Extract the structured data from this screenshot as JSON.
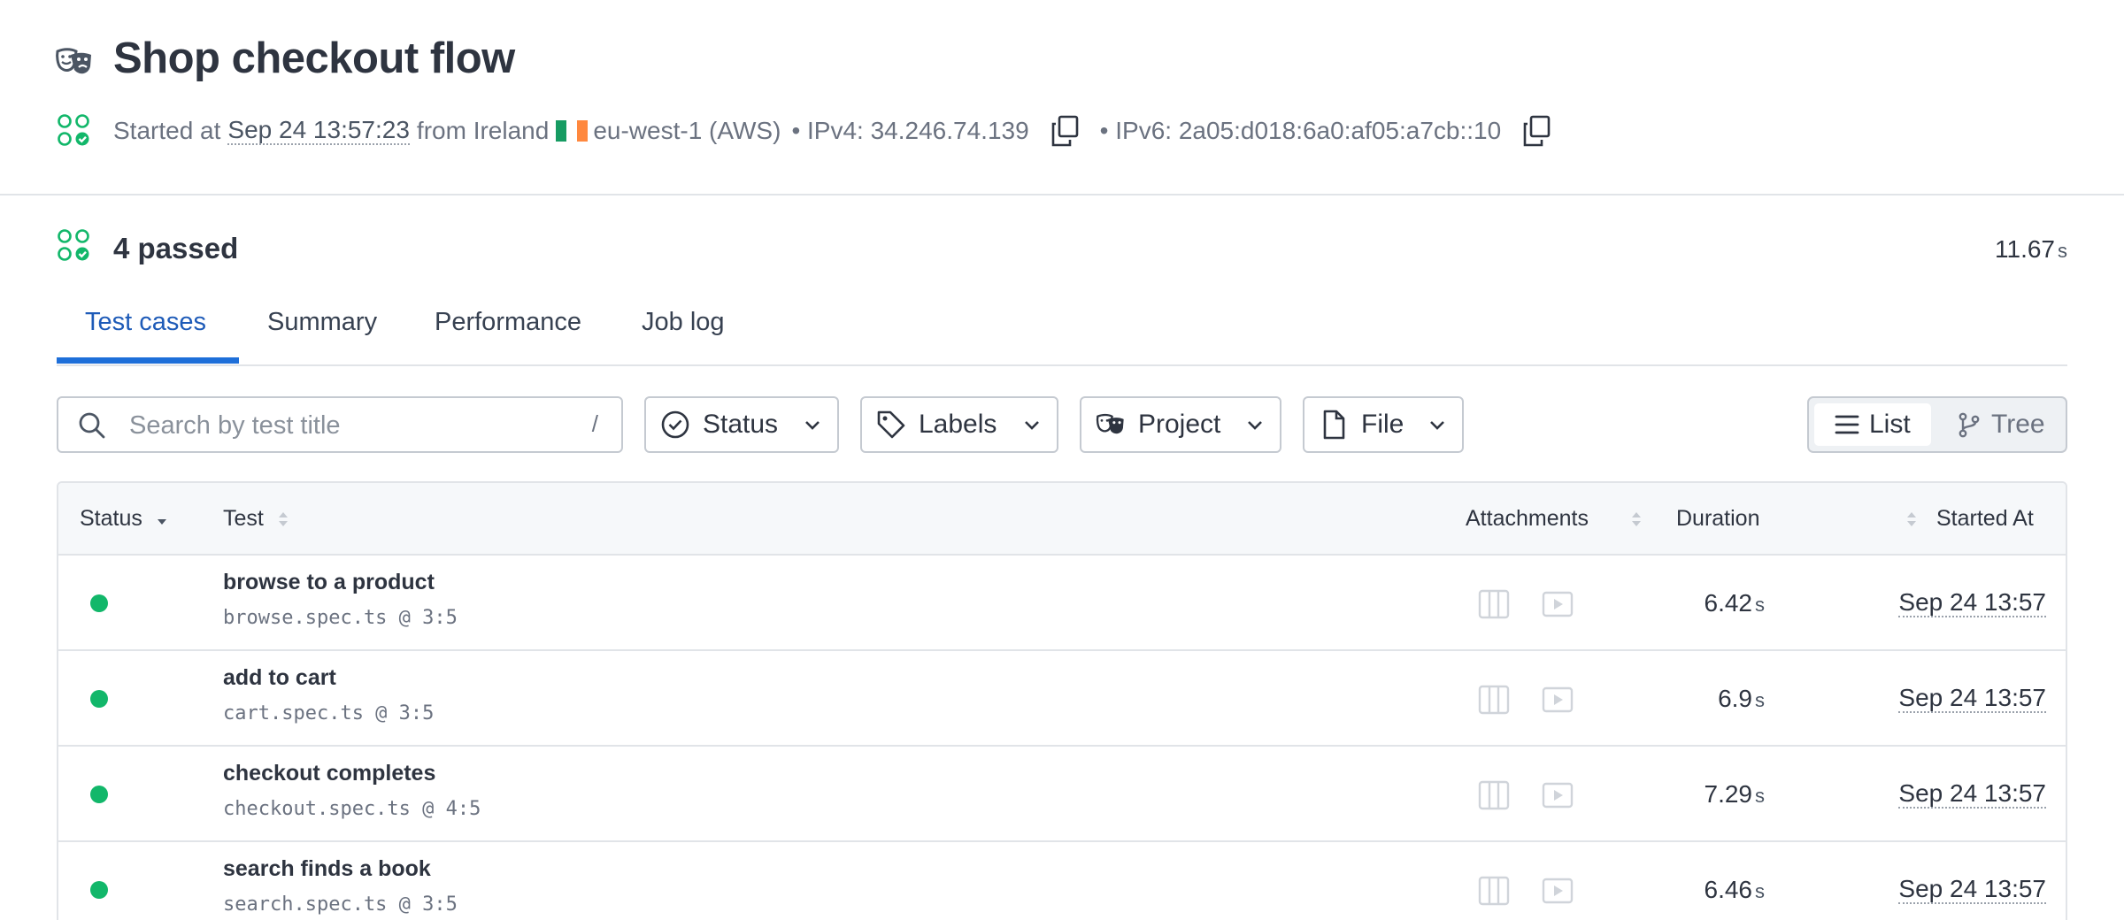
{
  "header": {
    "title": "Shop checkout flow",
    "started_prefix": "Started at",
    "started_date": "Sep 24 13:57:23",
    "from_text": "from Ireland",
    "region": "eu-west-1 (AWS)",
    "ipv4": "• IPv4: 34.246.74.139",
    "ipv6": "• IPv6: 2a05:d018:6a0:af05:a7cb::10"
  },
  "summary": {
    "passed": "4 passed",
    "total_duration": "11.67",
    "total_duration_unit": "s"
  },
  "tabs": [
    {
      "label": "Test cases",
      "active": true
    },
    {
      "label": "Summary",
      "active": false
    },
    {
      "label": "Performance",
      "active": false
    },
    {
      "label": "Job log",
      "active": false
    }
  ],
  "toolbar": {
    "search_placeholder": "Search by test title",
    "search_value": "",
    "search_shortcut": "/",
    "filters": {
      "status": "Status",
      "labels": "Labels",
      "project": "Project",
      "file": "File"
    },
    "view": {
      "list": "List",
      "tree": "Tree",
      "selected": "List"
    }
  },
  "table": {
    "columns": {
      "status": "Status",
      "test": "Test",
      "attachments": "Attachments",
      "duration": "Duration",
      "started_at": "Started At"
    },
    "rows": [
      {
        "status": "passed",
        "title": "browse to a product",
        "file": "browse.spec.ts @ 3:5",
        "duration": "6.42",
        "unit": "s",
        "started_at": "Sep 24 13:57"
      },
      {
        "status": "passed",
        "title": "add to cart",
        "file": "cart.spec.ts @ 3:5",
        "duration": "6.9",
        "unit": "s",
        "started_at": "Sep 24 13:57"
      },
      {
        "status": "passed",
        "title": "checkout completes",
        "file": "checkout.spec.ts @ 4:5",
        "duration": "7.29",
        "unit": "s",
        "started_at": "Sep 24 13:57"
      },
      {
        "status": "passed",
        "title": "search finds a book",
        "file": "search.spec.ts @ 3:5",
        "duration": "6.46",
        "unit": "s",
        "started_at": "Sep 24 13:57"
      }
    ]
  },
  "colors": {
    "accent": "#1e6fd9",
    "passed": "#12b76a",
    "flag_ireland": [
      "#169b62",
      "#ffffff",
      "#ff883e"
    ]
  },
  "icons": {
    "title": "theater-masks-icon",
    "run_status": "passed-circles-icon",
    "copy": "copy-icon",
    "search": "search-icon",
    "status_filter": "check-circle-icon",
    "labels_filter": "tag-icon",
    "project_filter": "theater-masks-icon",
    "file_filter": "file-icon",
    "list_view": "list-icon",
    "tree_view": "branch-icon",
    "trace": "trace-icon",
    "video": "video-icon"
  }
}
